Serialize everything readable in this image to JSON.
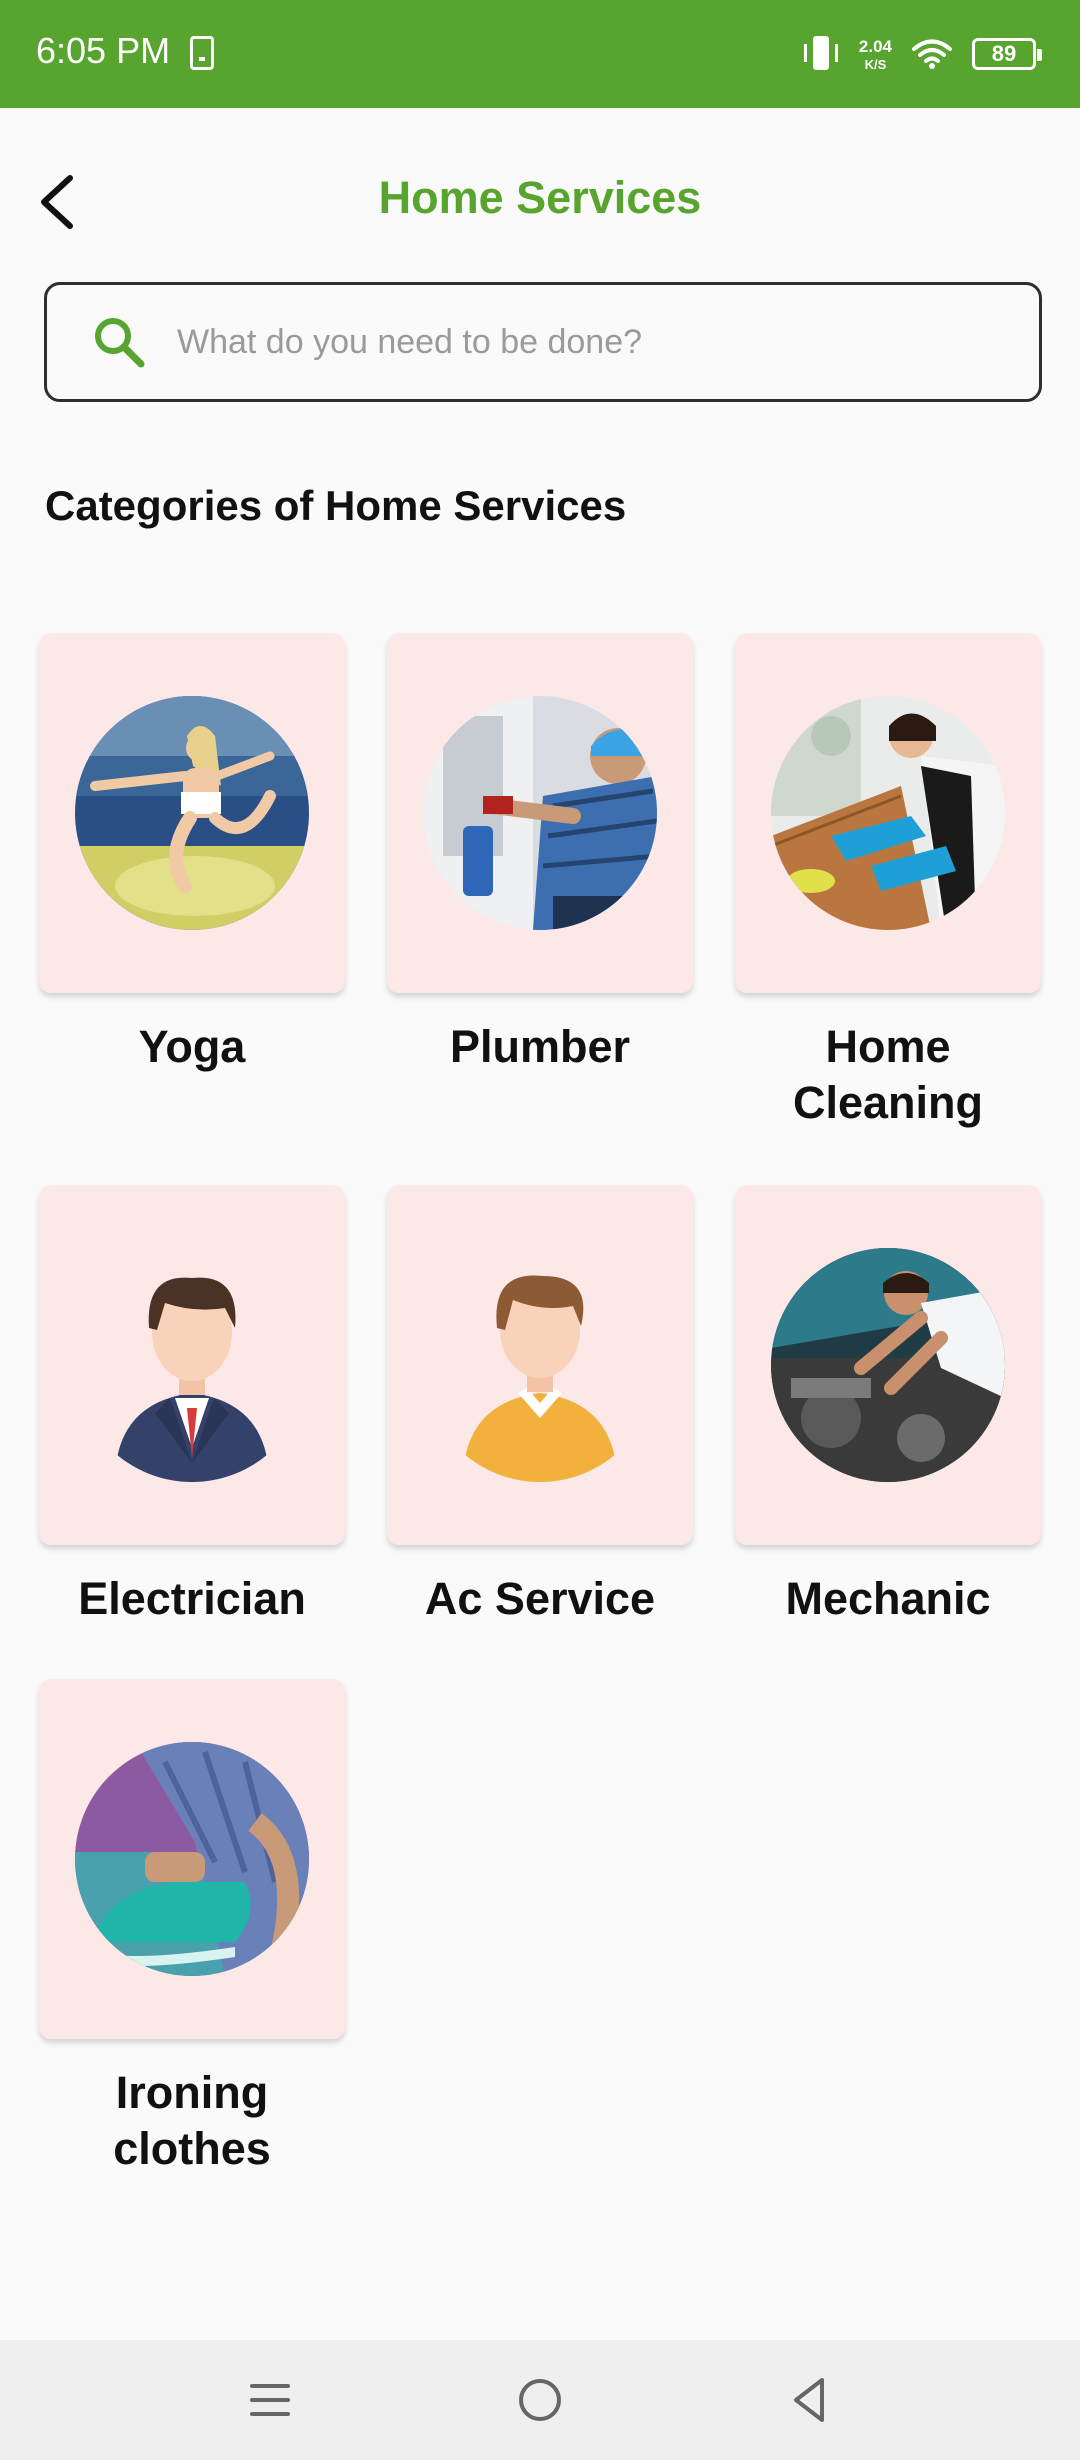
{
  "status_bar": {
    "time": "6:05 PM",
    "net_speed_value": "2.04",
    "net_speed_unit": "K/S",
    "battery_level": "89",
    "icons": [
      "download-icon",
      "vibrate-icon",
      "wifi-icon",
      "battery-icon"
    ]
  },
  "header": {
    "title": "Home Services",
    "back_icon": "chevron-left-icon"
  },
  "search": {
    "placeholder": "What do you need to be done?",
    "value": "",
    "icon": "search-icon"
  },
  "section_heading": "Categories of Home Services",
  "categories": [
    {
      "label": "Yoga"
    },
    {
      "label": "Plumber"
    },
    {
      "label": "Home Cleaning"
    },
    {
      "label": "Electrician"
    },
    {
      "label": "Ac Service"
    },
    {
      "label": "Mechanic"
    },
    {
      "label": "Ironing clothes"
    }
  ],
  "nav_bar": {
    "icons": [
      "menu-icon",
      "home-circle-icon",
      "back-triangle-icon"
    ]
  },
  "colors": {
    "brand_green": "#57a42e",
    "card_pink": "#fde8e8",
    "background": "#fafafa"
  }
}
